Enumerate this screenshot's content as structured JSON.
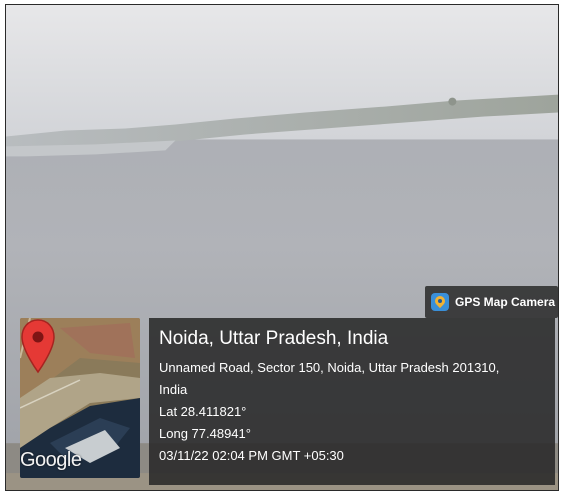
{
  "badge": {
    "label": "GPS Map Camera",
    "icon": "gps-map-camera-icon"
  },
  "map": {
    "logo": "Google",
    "marker_icon": "location-pin-icon",
    "marker_color": "#e53935"
  },
  "location": {
    "title": "Noida, Uttar Pradesh, India",
    "address_line1": "Unnamed Road, Sector 150, Noida, Uttar Pradesh 201310,",
    "address_line2": "India",
    "latitude": "Lat 28.411821°",
    "longitude": "Long 77.48941°",
    "datetime": "03/11/22 02:04 PM GMT +05:30"
  }
}
